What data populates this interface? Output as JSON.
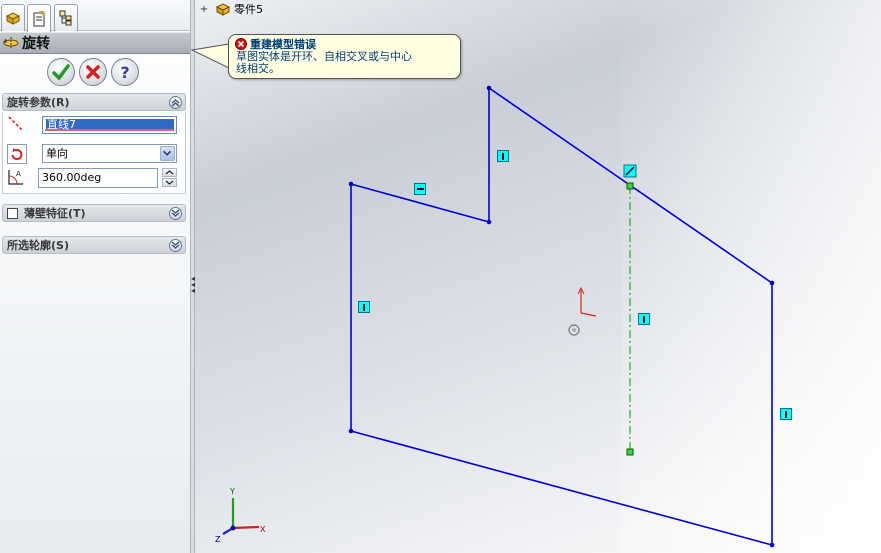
{
  "property_manager": {
    "title": "旋转",
    "rotation_params": {
      "header": "旋转参数(R)",
      "axis_value": "直线7",
      "direction_value": "单向",
      "angle_value": "360.00deg"
    },
    "thin_feature": {
      "header": "薄壁特征(T)",
      "checked": false
    },
    "selected_contours": {
      "header": "所选轮廓(S)"
    }
  },
  "feature_tree": {
    "part_name": "零件5",
    "expander": "+"
  },
  "error_tooltip": {
    "title": "重建模型错误",
    "message_line1": "草图实体是开环、自相交叉或与中心",
    "message_line2": "线相交。"
  },
  "colors": {
    "sketch_line": "#0000e0",
    "centerline": "#00a000",
    "relation_marker_bg": "#00ffff",
    "tooltip_bg": "#ffffe1",
    "error_text": "#003d79"
  }
}
